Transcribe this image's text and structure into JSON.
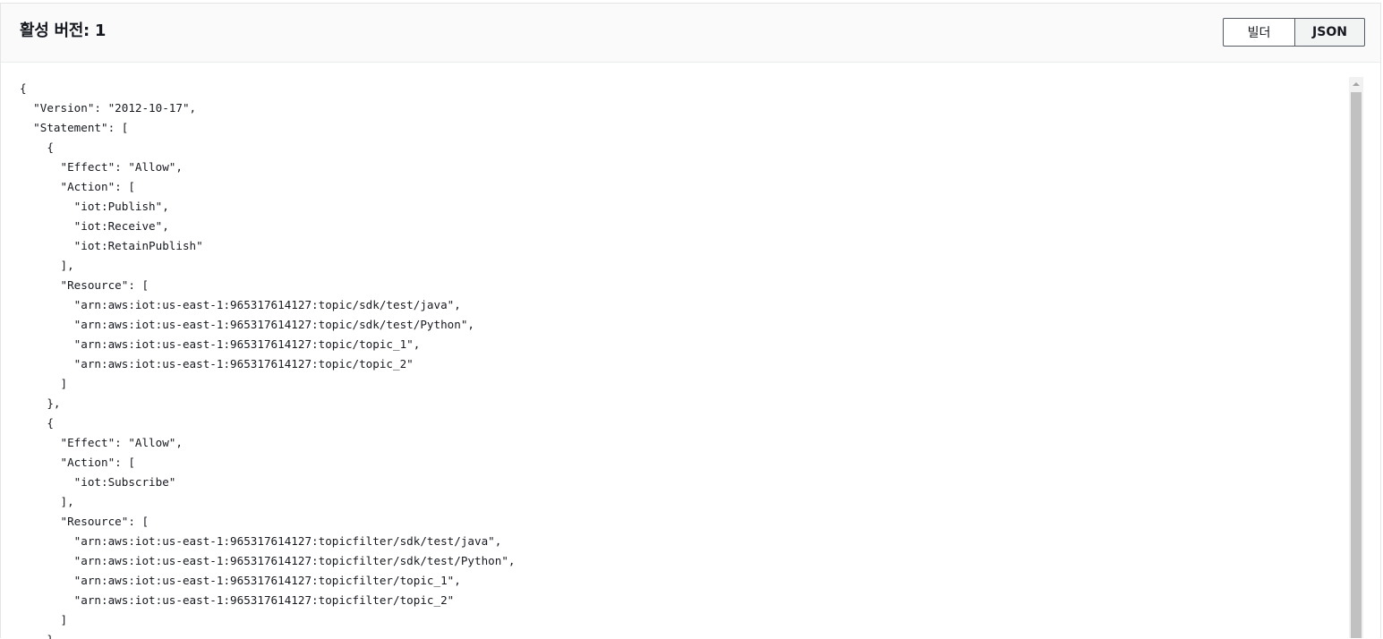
{
  "header": {
    "title": "활성 버전: 1"
  },
  "view_toggle": {
    "builder_label": "빌더",
    "json_label": "JSON",
    "selected": "JSON"
  },
  "editor": {
    "lines": [
      "{",
      "  \"Version\": \"2012-10-17\",",
      "  \"Statement\": [",
      "    {",
      "      \"Effect\": \"Allow\",",
      "      \"Action\": [",
      "        \"iot:Publish\",",
      "        \"iot:Receive\",",
      "        \"iot:RetainPublish\"",
      "      ],",
      "      \"Resource\": [",
      "        \"arn:aws:iot:us-east-1:965317614127:topic/sdk/test/java\",",
      "        \"arn:aws:iot:us-east-1:965317614127:topic/sdk/test/Python\",",
      "        \"arn:aws:iot:us-east-1:965317614127:topic/topic_1\",",
      "        \"arn:aws:iot:us-east-1:965317614127:topic/topic_2\"",
      "      ]",
      "    },",
      "    {",
      "      \"Effect\": \"Allow\",",
      "      \"Action\": [",
      "        \"iot:Subscribe\"",
      "      ],",
      "      \"Resource\": [",
      "        \"arn:aws:iot:us-east-1:965317614127:topicfilter/sdk/test/java\",",
      "        \"arn:aws:iot:us-east-1:965317614127:topicfilter/sdk/test/Python\",",
      "        \"arn:aws:iot:us-east-1:965317614127:topicfilter/topic_1\",",
      "        \"arn:aws:iot:us-east-1:965317614127:topicfilter/topic_2\"",
      "      ]",
      "    },"
    ]
  },
  "colors": {
    "text": "#16191f",
    "header_bg": "#fafafa",
    "toggle_border": "#545b64",
    "toggle_selected_bg": "#f2f3f3",
    "scroll_thumb": "#c1c1c1"
  },
  "icons": {
    "scroll_up": "scroll-up-arrow-icon"
  }
}
